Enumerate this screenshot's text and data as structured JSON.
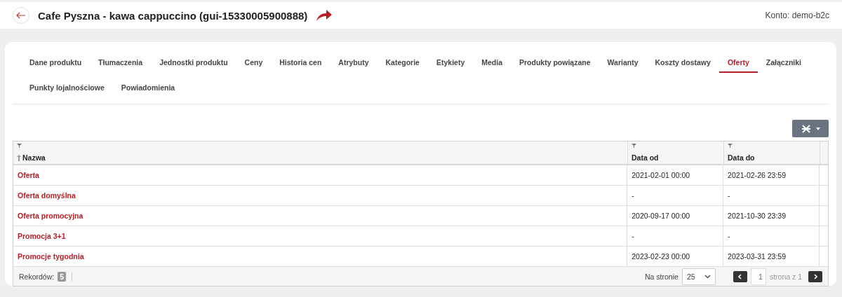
{
  "header": {
    "title": "Cafe Pyszna - kawa cappuccino (gui-15330005900888)",
    "account_label": "Konto:",
    "account": "demo-b2c"
  },
  "tabs": [
    {
      "label": "Dane produktu",
      "selected": false
    },
    {
      "label": "Tłumaczenia",
      "selected": false
    },
    {
      "label": "Jednostki produktu",
      "selected": false
    },
    {
      "label": "Ceny",
      "selected": false
    },
    {
      "label": "Historia cen",
      "selected": false
    },
    {
      "label": "Atrybuty",
      "selected": false
    },
    {
      "label": "Kategorie",
      "selected": false
    },
    {
      "label": "Etykiety",
      "selected": false
    },
    {
      "label": "Media",
      "selected": false
    },
    {
      "label": "Produkty powiązane",
      "selected": false
    },
    {
      "label": "Warianty",
      "selected": false
    },
    {
      "label": "Koszty dostawy",
      "selected": false
    },
    {
      "label": "Oferty",
      "selected": true
    },
    {
      "label": "Załączniki",
      "selected": false
    },
    {
      "label": "Punkty lojalnościowe",
      "selected": false
    },
    {
      "label": "Powiadomienia",
      "selected": false
    }
  ],
  "table": {
    "columns": [
      "Nazwa",
      "Data od",
      "Data do"
    ],
    "rows": [
      {
        "name": "Oferta",
        "from": "2021-02-01 00:00",
        "to": "2021-02-26 23:59"
      },
      {
        "name": "Oferta domyślna",
        "from": "-",
        "to": "-"
      },
      {
        "name": "Oferta promocyjna",
        "from": "2020-09-17 00:00",
        "to": "2021-10-30 23:39"
      },
      {
        "name": "Promocja 3+1",
        "from": "-",
        "to": "-"
      },
      {
        "name": "Promocje tygodnia",
        "from": "2023-02-23 00:00",
        "to": "2023-03-31 23:59"
      }
    ]
  },
  "footer": {
    "records_label": "Rekordów:",
    "records": "5",
    "per_page_label": "Na stronie",
    "per_page": "25",
    "page": "1",
    "page_of": "strona z 1"
  }
}
